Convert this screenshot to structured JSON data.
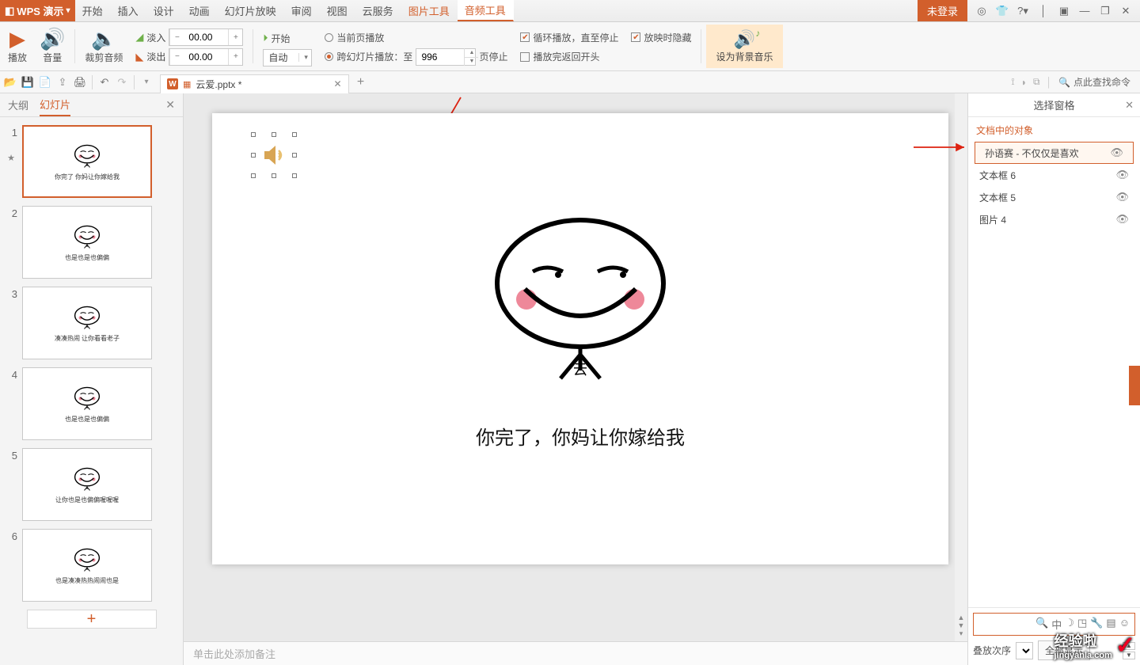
{
  "app": {
    "name": "WPS 演示",
    "login": "未登录"
  },
  "tabs": {
    "items": [
      "开始",
      "插入",
      "设计",
      "动画",
      "幻灯片放映",
      "审阅",
      "视图",
      "云服务",
      "图片工具",
      "音频工具"
    ],
    "activeIndex": 9
  },
  "ribbon": {
    "play": "播放",
    "volume": "音量",
    "trim": "裁剪音频",
    "fadeIn": "淡入",
    "fadeInVal": "00.00",
    "fadeOut": "淡出",
    "fadeOutVal": "00.00",
    "start": "开始",
    "startIcon": "⏻",
    "currentPage": "当前页播放",
    "crossSlide": "跨幻灯片播放：至",
    "crossVal": "996",
    "pageStop": "页停止",
    "loopUntil": "循环播放，直至停止",
    "hideOnPlay": "放映时隐藏",
    "returnStart": "播放完返回开头",
    "auto": "自动",
    "bgMusic": "设为背景音乐"
  },
  "qa": {
    "open": "📂",
    "save": "💾",
    "pdf": "📄",
    "export": "⇪",
    "print": "🖨",
    "undo": "↶",
    "redo": "↷"
  },
  "doc": {
    "name": "云爱.pptx *",
    "addNotesHint": "单击此处添加备注",
    "searchCmd": "点此查找命令"
  },
  "nav": {
    "outline": "大纲",
    "slides": "幻灯片",
    "activeSlide": 1,
    "count": 6
  },
  "slide": {
    "caption": "你完了，你妈让你嫁给我",
    "cloud": "云"
  },
  "thumbs": [
    "你完了 你妈让你嫁给我",
    "也是也是也偏偏",
    "凑凑热闹 让你看看老子",
    "也是也是也偏偏",
    "让你也是也偏偏喔喔喔",
    "也是凑凑热热闹闹也是"
  ],
  "rightPane": {
    "title": "选择窗格",
    "header": "文档中的对象",
    "items": [
      {
        "label": "孙语赛 - 不仅仅是喜欢",
        "selected": true
      },
      {
        "label": "文本框 6",
        "selected": false
      },
      {
        "label": "文本框 5",
        "selected": false
      },
      {
        "label": "图片 4",
        "selected": false
      }
    ],
    "showAll": "全部显示",
    "orderLabel": "叠放次序"
  },
  "watermark": {
    "brand": "经验啦",
    "sub": "jingyanla.com"
  }
}
